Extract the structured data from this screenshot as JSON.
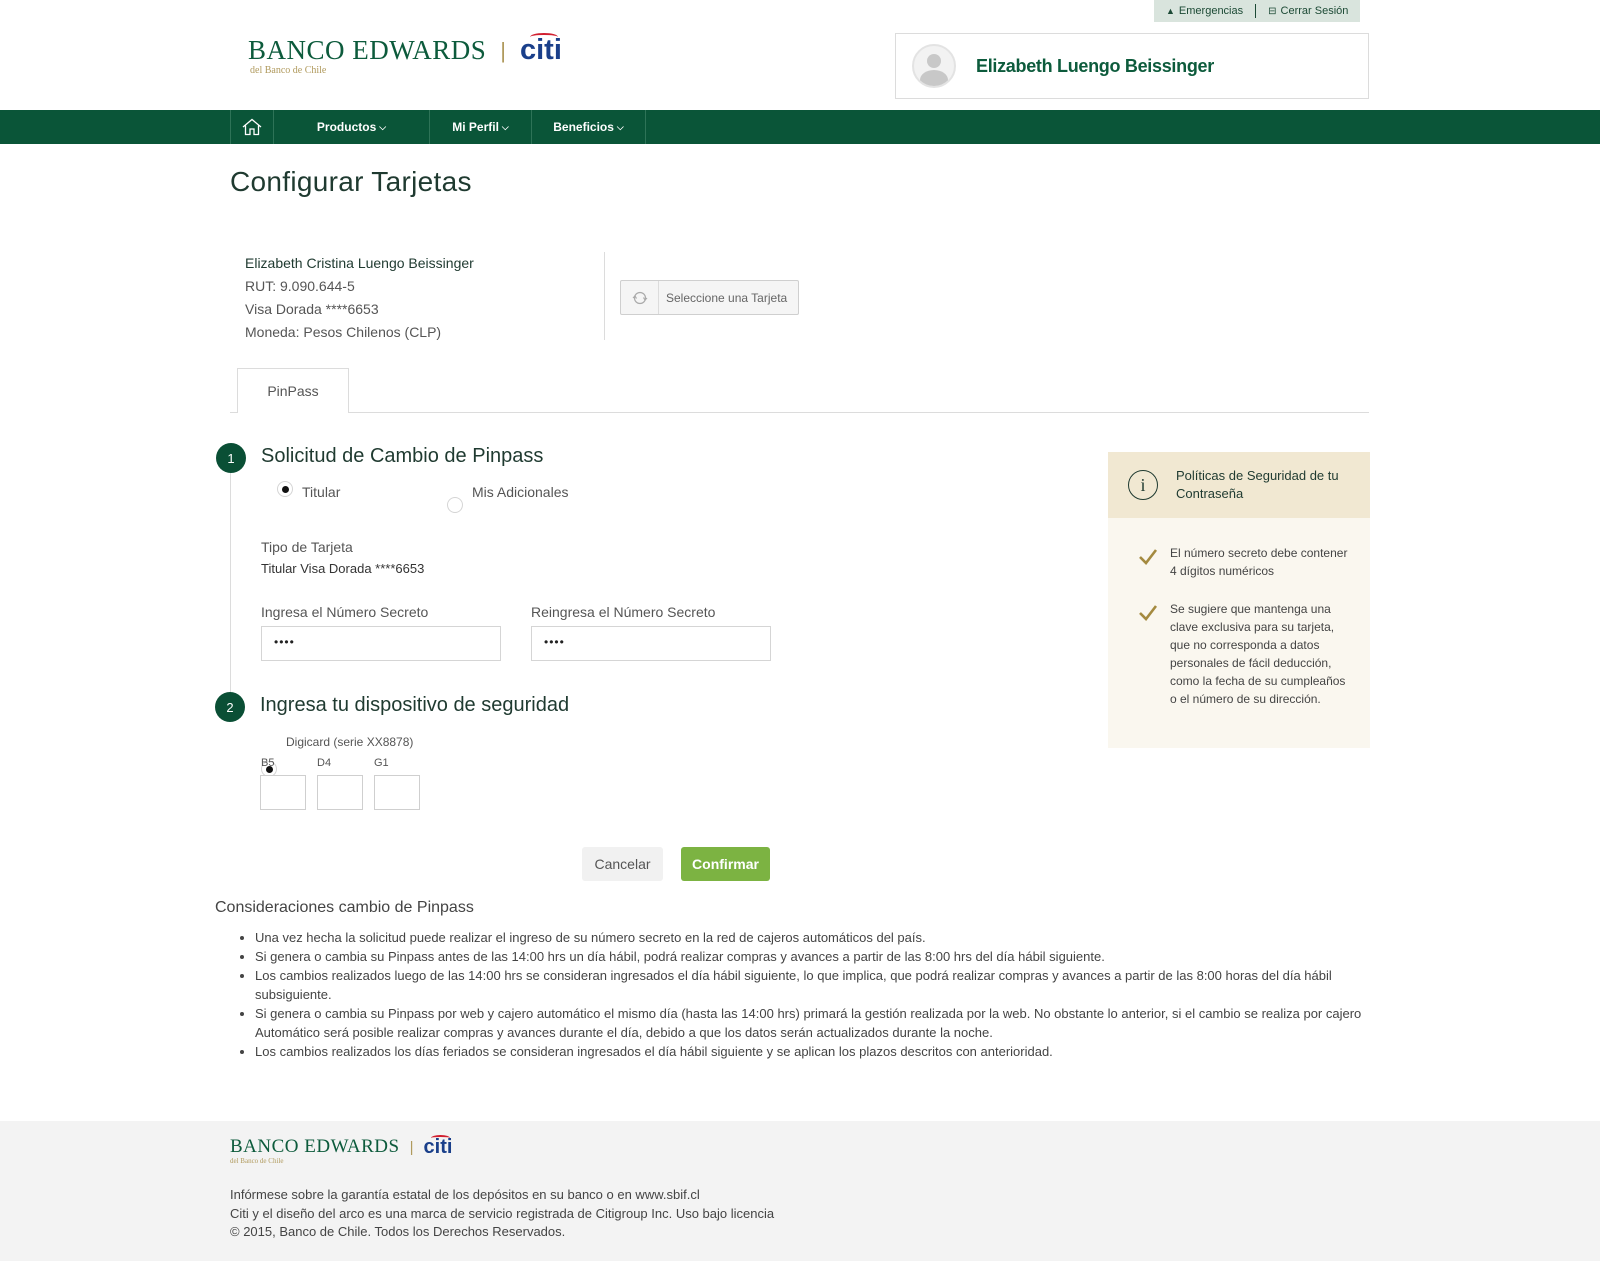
{
  "top_links": {
    "emergencias": "Emergencias",
    "cerrar_sesion": "Cerrar Sesión"
  },
  "brand": {
    "bank": "BANCO EDWARDS",
    "citi": "citi",
    "sub": "del Banco de Chile"
  },
  "user": {
    "name": "Elizabeth Luengo Beissinger"
  },
  "nav": {
    "productos": "Productos",
    "mi_perfil": "Mi Perfil",
    "beneficios": "Beneficios"
  },
  "page": {
    "title": "Configurar Tarjetas"
  },
  "card_info": {
    "full_name": "Elizabeth Cristina Luengo Beissinger",
    "rut": "RUT: 9.090.644-5",
    "card": "Visa Dorada ****6653",
    "currency": "Moneda: Pesos Chilenos (CLP)"
  },
  "select_card": {
    "label": "Seleccione una Tarjeta"
  },
  "tabs": {
    "pinpass": "PinPass"
  },
  "step1": {
    "number": "1",
    "title": "Solicitud de Cambio de Pinpass",
    "radio_titular": "Titular",
    "radio_adicionales": "Mis Adicionales",
    "tipo_label": "Tipo de Tarjeta",
    "tipo_value": "Titular Visa Dorada ****6653",
    "secret_label": "Ingresa el Número Secreto",
    "secret_value": "••••",
    "secret2_label": "Reingresa el Número Secreto",
    "secret2_value": "••••"
  },
  "step2": {
    "number": "2",
    "title": "Ingresa tu dispositivo de seguridad",
    "device": "Digicard (serie XX8878)",
    "coords": [
      "B5",
      "D4",
      "G1"
    ]
  },
  "actions": {
    "cancel": "Cancelar",
    "confirm": "Confirmar"
  },
  "considerations": {
    "title": "Consideraciones cambio de Pinpass",
    "items": [
      "Una vez hecha la solicitud puede realizar el ingreso de su número secreto en la red de cajeros automáticos del país.",
      "Si genera o cambia su Pinpass antes de las 14:00 hrs un día hábil, podrá realizar compras y avances a partir de las 8:00 hrs del día hábil siguiente.",
      "Los cambios realizados luego de las 14:00 hrs se consideran ingresados el día hábil siguiente, lo que implica, que podrá realizar compras y avances a partir de las 8:00 horas del día hábil subsiguiente.",
      "Si genera o cambia su Pinpass por web y cajero automático el mismo día (hasta las 14:00 hrs) primará la gestión realizada por la web. No obstante lo anterior, si el cambio se realiza por cajero Automático será posible realizar compras y avances durante el día, debido a que los datos serán actualizados durante la noche.",
      "Los cambios realizados los días feriados se consideran ingresados el día hábil siguiente y se aplican los plazos descritos con anterioridad."
    ]
  },
  "policy": {
    "title": "Políticas de Seguridad de tu Contraseña",
    "items": [
      "El número secreto debe contener 4 dígitos numéricos",
      "Se sugiere que mantenga una clave exclusiva para su tarjeta, que no corresponda a datos personales de fácil deducción, como la fecha de su cumpleaños o el número de su dirección."
    ]
  },
  "footer": {
    "line1": "Infórmese sobre la garantía estatal de los depósitos en su banco o en www.sbif.cl",
    "line2": "Citi y el diseño del arco es una marca de servicio registrada de Citigroup Inc. Uso bajo licencia",
    "line3": "© 2015, Banco de Chile. Todos los Derechos Reservados."
  },
  "colors": {
    "brand_green": "#0a5538",
    "confirm_green": "#7cb342",
    "gold": "#b09a5d",
    "citi_blue": "#1a3f8a",
    "citi_red": "#d11f2f"
  }
}
